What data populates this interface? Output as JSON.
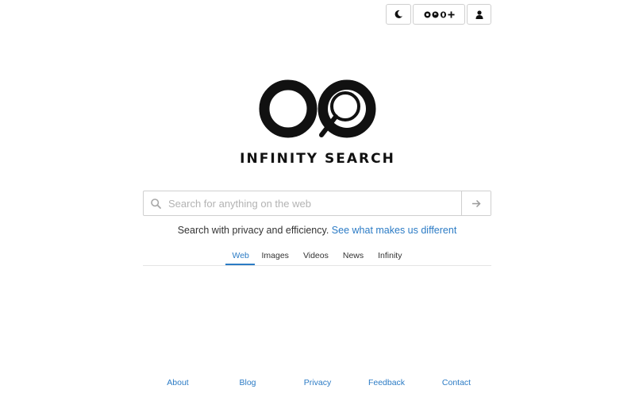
{
  "header": {
    "theme_toggle_icon": "moon-icon",
    "browser_icons": [
      "chrome-icon",
      "firefox-icon",
      "opera-icon",
      "add-icon"
    ],
    "account_icon": "user-icon"
  },
  "brand": {
    "name": "INFINITY SEARCH",
    "logo_icon": "infinity-magnifier-logo"
  },
  "search": {
    "placeholder": "Search for anything on the web",
    "value": "",
    "submit_icon": "arrow-right-icon"
  },
  "tagline": {
    "text": "Search with privacy and efficiency.",
    "link": "See what makes us different"
  },
  "tabs": [
    {
      "label": "Web",
      "active": true
    },
    {
      "label": "Images",
      "active": false
    },
    {
      "label": "Videos",
      "active": false
    },
    {
      "label": "News",
      "active": false
    },
    {
      "label": "Infinity",
      "active": false
    }
  ],
  "footer": {
    "links": [
      "About",
      "Blog",
      "Privacy",
      "Feedback",
      "Contact"
    ]
  },
  "colors": {
    "accent": "#2b7bc5",
    "border": "#cfcfcf",
    "brand": "#111111"
  }
}
